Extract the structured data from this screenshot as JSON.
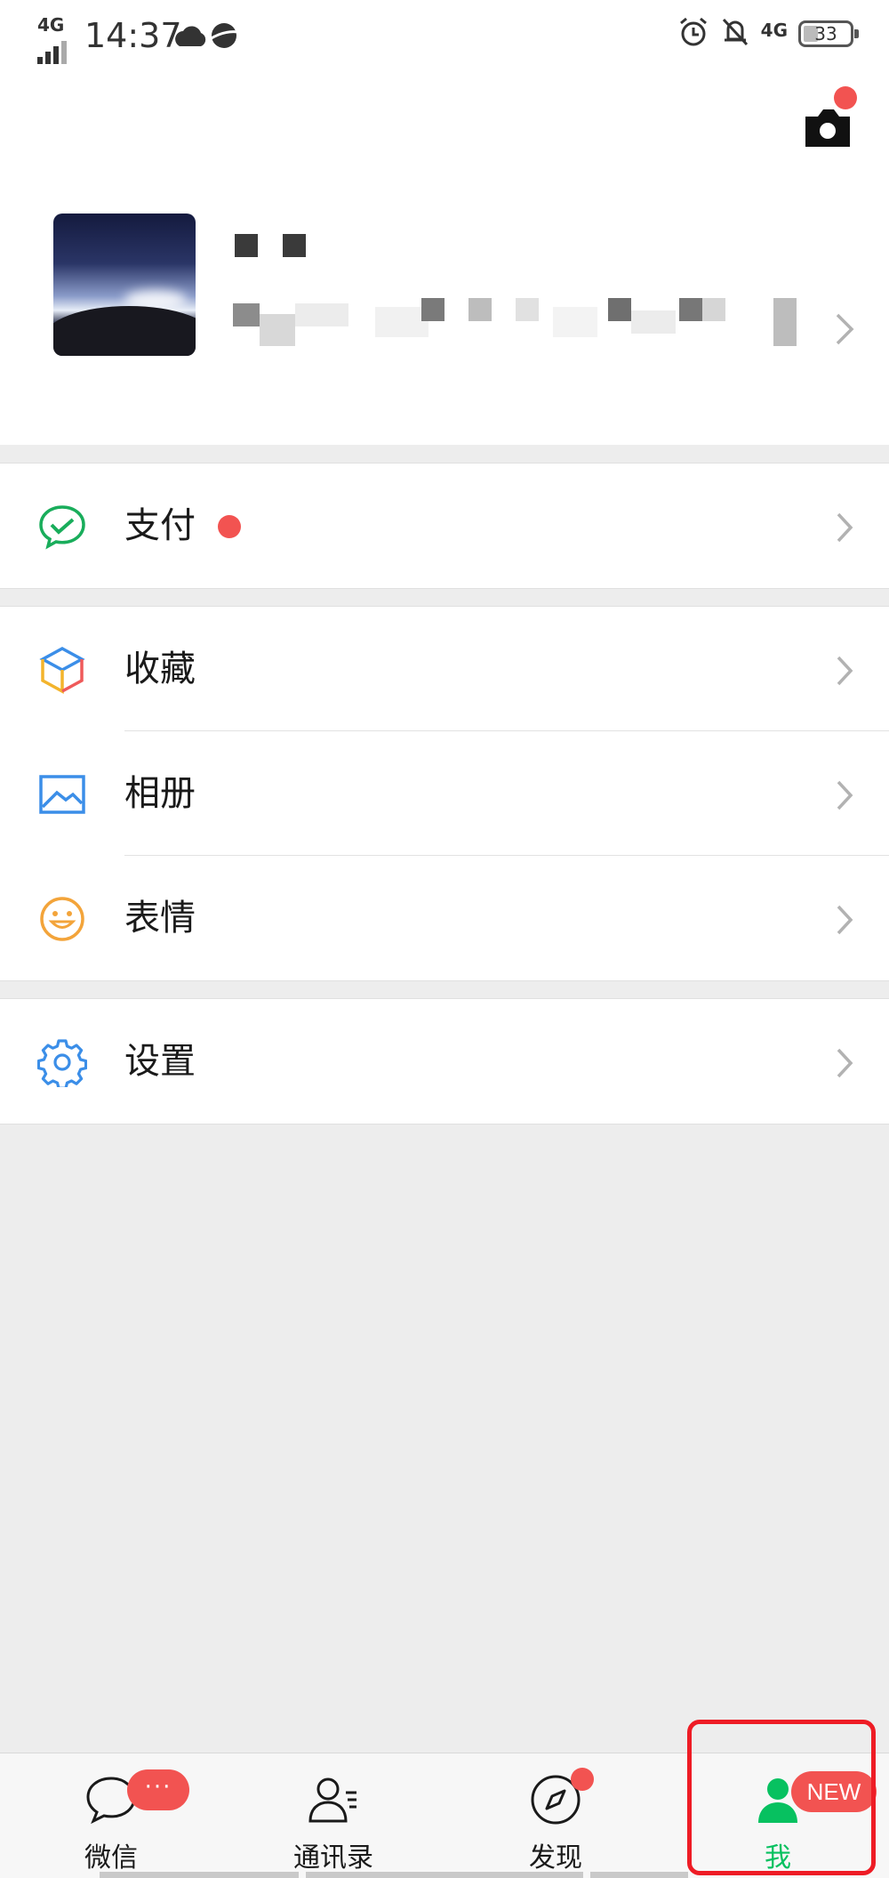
{
  "status_bar": {
    "network": "4G",
    "time": "14:37",
    "network_right": "4G",
    "battery_level": "33",
    "icons": [
      "signal-icon",
      "weather-icon",
      "browser-icon",
      "alarm-icon",
      "mute-icon",
      "battery-icon"
    ]
  },
  "profile": {
    "name": "",
    "wechat_id": "",
    "camera_icon": "camera-icon",
    "has_camera_badge": true
  },
  "menu": {
    "pay": {
      "label": "支付",
      "icon": "wechat-pay-icon",
      "has_dot": true
    },
    "favorites": {
      "label": "收藏",
      "icon": "cube-icon"
    },
    "album": {
      "label": "相册",
      "icon": "image-icon"
    },
    "stickers": {
      "label": "表情",
      "icon": "smile-icon"
    },
    "settings": {
      "label": "设置",
      "icon": "gear-icon"
    }
  },
  "tabs": [
    {
      "label": "微信",
      "icon": "chat-bubble-icon",
      "badge": "···"
    },
    {
      "label": "通讯录",
      "icon": "contacts-icon"
    },
    {
      "label": "发现",
      "icon": "compass-icon",
      "has_dot": true
    },
    {
      "label": "我",
      "icon": "person-icon",
      "badge": "NEW",
      "active": true
    }
  ],
  "colors": {
    "accent_green": "#07c160",
    "badge_red": "#f25351",
    "highlight_red": "#ee1c25",
    "background": "#ededed"
  }
}
